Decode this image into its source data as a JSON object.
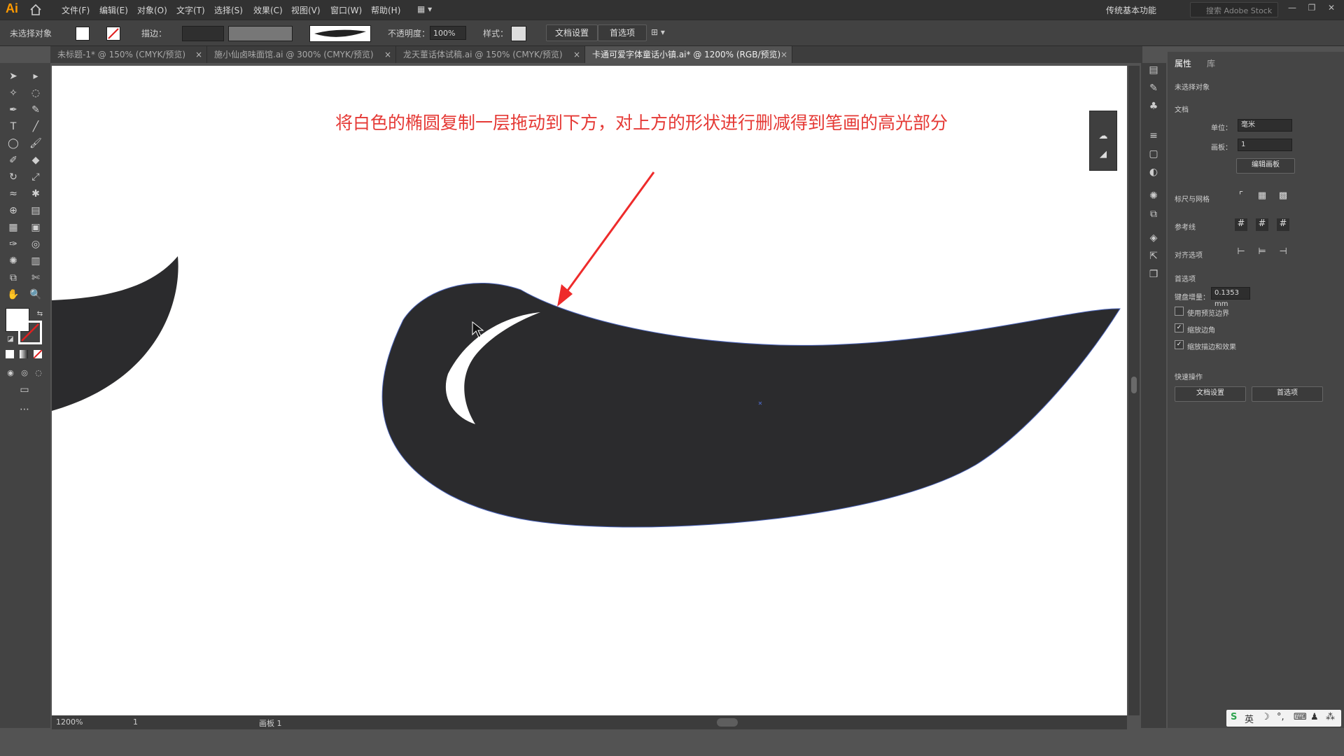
{
  "app": {
    "logo": "Ai"
  },
  "menu": [
    {
      "label": "文件(F)"
    },
    {
      "label": "编辑(E)"
    },
    {
      "label": "对象(O)"
    },
    {
      "label": "文字(T)"
    },
    {
      "label": "选择(S)"
    },
    {
      "label": "效果(C)"
    },
    {
      "label": "视图(V)"
    },
    {
      "label": "窗口(W)"
    },
    {
      "label": "帮助(H)"
    }
  ],
  "workspace": "传统基本功能",
  "search_placeholder": "搜索 Adobe Stock",
  "control": {
    "selection": "未选择对象",
    "stroke_label": "描边：",
    "opacity_label": "不透明度：",
    "opacity_value": "100%",
    "style_label": "样式：",
    "doc_setup": "文档设置",
    "preferences": "首选项"
  },
  "tabs": [
    {
      "label": "未标题-1* @ 150% (CMYK/预览)",
      "active": false
    },
    {
      "label": "施小仙卤味面馆.ai @ 300% (CMYK/预览)",
      "active": false
    },
    {
      "label": "龙天董话体试稿.ai @ 150% (CMYK/预览)",
      "active": false
    },
    {
      "label": "卡通可爱字体童话小镇.ai* @ 1200% (RGB/预览)",
      "active": true
    }
  ],
  "annotation": "将白色的椭圆复制一层拖动到下方，对上方的形状进行删减得到笔画的高光部分",
  "status": {
    "zoom": "1200%",
    "artboard_num": "1",
    "artboard_label": "画板 1"
  },
  "properties": {
    "tab_props": "属性",
    "tab_library": "库",
    "no_selection": "未选择对象",
    "doc_section": "文档",
    "unit_label": "单位：",
    "unit_value": "毫米",
    "artboard_label": "画板：",
    "artboard_value": "1",
    "edit_artboard": "编辑画板",
    "rulers_grid": "标尺与网格",
    "guides": "参考线",
    "snap_options": "对齐选项",
    "prefs_section": "首选项",
    "keyboard_increment_label": "键盘增量：",
    "keyboard_increment_value": "0.1353 mm",
    "use_preview_bounds": "使用预览边界",
    "scale_corners": "缩放边角",
    "scale_strokes": "缩放描边和效果",
    "quick_actions": "快速操作",
    "qa_doc_setup": "文档设置",
    "qa_prefs": "首选项"
  },
  "checkboxes": {
    "use_preview_bounds": false,
    "scale_corners": true,
    "scale_strokes": true
  },
  "ime": {
    "lang": "英"
  },
  "colors": {
    "annotation": "#e53935",
    "shape": "#2b2b2d",
    "arrow": "#ee2b2b"
  }
}
